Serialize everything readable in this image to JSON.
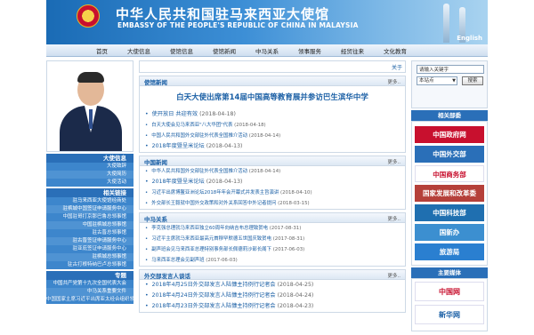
{
  "header": {
    "title_cn": "中华人民共和国驻马来西亚大使馆",
    "title_en": "EMBASSY OF THE PEOPLE'S REPUBLIC OF CHINA IN MALAYSIA",
    "english_link": "English"
  },
  "nav": {
    "items": [
      "首页",
      "大使信息",
      "使馆信息",
      "使馆新闻",
      "中马关系",
      "领事服务",
      "经贸往来",
      "文化教育"
    ]
  },
  "left": {
    "sections": [
      {
        "title": "大使信息",
        "items": [
          "大使致辞",
          "大使简历",
          "大使活动"
        ]
      },
      {
        "title": "相关链接",
        "items": [
          "驻马来西亚大使馆经商处",
          "驻槟城中国签证申请服务中心",
          "中国驻哥打京那巴鲁总领事馆",
          "中国驻槟城总领事馆",
          "驻古晋总领事馆",
          "驻古晋签证申请服务中心",
          "驻亚庇签证申请服务中心",
          "驻槟城总领事馆",
          "驻古打根特纳巴卢总领事馆"
        ]
      },
      {
        "title": "专题",
        "items": [
          "中国共产党第十九次全国代表大会",
          "中马关系重要文件",
          "中国国家主席习近平出席亚太经合组织领导人非正式会议"
        ]
      }
    ]
  },
  "ticker": {
    "text": "关于"
  },
  "sections": [
    {
      "title": "使馆新闻",
      "more": "更多..",
      "headline": "白天大使出席第14届中国高等教育展并参访巴生滨华中学",
      "items": [
        {
          "text": "使开放日 共迎有效",
          "date": "(2018-04-18)",
          "small": false
        },
        {
          "text": "白天大使会见马来西亚\"八大华团\"代表",
          "date": "(2018-04-18)",
          "small": true
        },
        {
          "text": "中国人民共和国外交部驻外代表全国推介活动",
          "date": "(2018-04-14)",
          "small": true
        },
        {
          "text": "2018年度暨呈米论坛",
          "date": "(2018-04-13)",
          "small": false
        }
      ]
    },
    {
      "title": "中国新闻",
      "more": "更多..",
      "headline": "",
      "items": [
        {
          "text": "中华人民共和国外交部驻外代表全国推介活动",
          "date": "(2018-04-14)",
          "small": true
        },
        {
          "text": "2018年度暨呈米论坛",
          "date": "(2018-04-13)",
          "small": false
        },
        {
          "text": "习近平出席博鳌亚洲论坛2018年年会开幕式并发表主旨演讲",
          "date": "(2018-04-10)",
          "small": true
        },
        {
          "text": "外交部长王毅就中国外交政策和对外关系回答中外记者提问",
          "date": "(2018-03-15)",
          "small": true
        }
      ]
    },
    {
      "title": "中马关系",
      "more": "更多..",
      "headline": "",
      "items": [
        {
          "text": "李克强总理就马来西亚独立60周年向纳吉布总理致贺电",
          "date": "(2017-08-31)",
          "small": true
        },
        {
          "text": "习近平主席就马来西亚最高元首穆罕默德五世国庆致贺电",
          "date": "(2017-08-31)",
          "small": true
        },
        {
          "text": "副声班会见马来西亚总理特别事务部长佩德莉沙部长阁下",
          "date": "(2017-06-03)",
          "small": true
        },
        {
          "text": "马来西亚总理会见副声班",
          "date": "(2017-06-03)",
          "small": true
        }
      ]
    },
    {
      "title": "外交部发言人谈话",
      "more": "更多..",
      "headline": "",
      "items": [
        {
          "text": "2018年4月25日外交部发言人陆慷主持例行记者会",
          "date": "(2018-04-25)",
          "small": false
        },
        {
          "text": "2018年4月24日外交部发言人陆慷主持例行记者会",
          "date": "(2018-04-24)",
          "small": false
        },
        {
          "text": "2018年4月23日外交部发言人陆慷主持例行记者会",
          "date": "(2018-04-23)",
          "small": false
        }
      ]
    }
  ],
  "right": {
    "search": {
      "placeholder": "请输入关键字",
      "scope": "本站点",
      "button": "搜索"
    },
    "links_title": "相关部委",
    "links": [
      {
        "label": "中国政府网",
        "color": "#c8102e"
      },
      {
        "label": "中国外交部",
        "color": "#2a6fb8"
      },
      {
        "label": "中国商务部",
        "color": "#ffffff"
      },
      {
        "label": "国家发展和改革委",
        "color": "#b5403a"
      },
      {
        "label": "中国科技部",
        "color": "#1f6fb0"
      },
      {
        "label": "国新办",
        "color": "#3c8fd0"
      },
      {
        "label": "旅游局",
        "color": "#2a7fd0"
      }
    ],
    "media_title": "主要媒体",
    "media": [
      {
        "label": "中国网"
      },
      {
        "label": "新华网"
      }
    ]
  }
}
